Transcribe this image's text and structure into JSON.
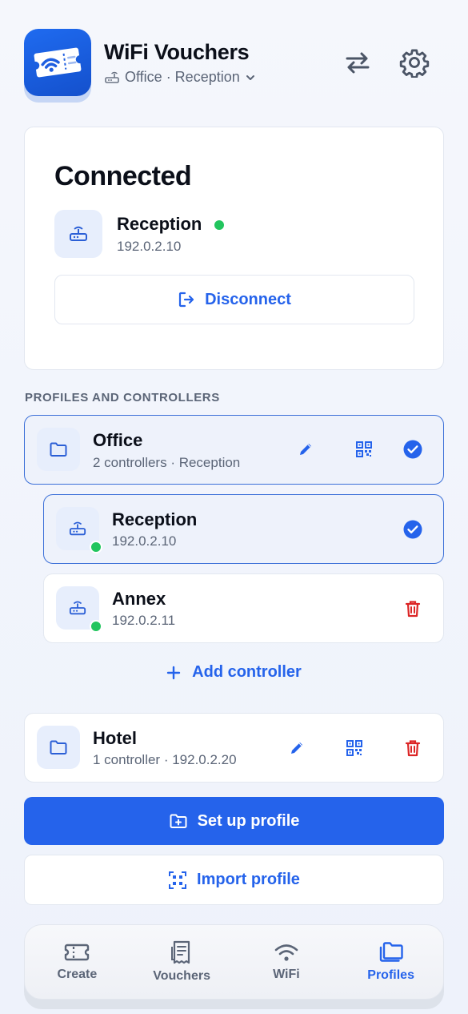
{
  "header": {
    "app_title": "WiFi Vouchers",
    "profile_path": "Office · Reception",
    "icons": [
      "ticket-wifi-icon",
      "router-icon",
      "chevron-down-icon",
      "swap-icon",
      "gear-icon"
    ]
  },
  "connection": {
    "status": "Connected",
    "controller_name": "Reception",
    "controller_ip": "192.0.2.10",
    "status_color": "#22c55e",
    "disconnect_label": "Disconnect"
  },
  "section_label": "PROFILES AND CONTROLLERS",
  "profiles": [
    {
      "name": "Office",
      "subtitle": "2 controllers · Reception",
      "active": true,
      "controllers": [
        {
          "name": "Reception",
          "ip": "192.0.2.10",
          "online": true,
          "selected": true
        },
        {
          "name": "Annex",
          "ip": "192.0.2.11",
          "online": true,
          "selected": false
        }
      ],
      "add_controller_label": "Add controller"
    },
    {
      "name": "Hotel",
      "subtitle": "1 controller · 192.0.2.20",
      "active": false
    }
  ],
  "actions": {
    "setup_label": "Set up profile",
    "import_label": "Import profile"
  },
  "tabs": [
    {
      "label": "Create",
      "icon": "ticket-icon",
      "active": false
    },
    {
      "label": "Vouchers",
      "icon": "receipt-icon",
      "active": false
    },
    {
      "label": "WiFi",
      "icon": "wifi-icon",
      "active": false
    },
    {
      "label": "Profiles",
      "icon": "folders-icon",
      "active": true
    }
  ],
  "colors": {
    "accent": "#2563eb",
    "online": "#22c55e",
    "danger": "#dc2626"
  }
}
